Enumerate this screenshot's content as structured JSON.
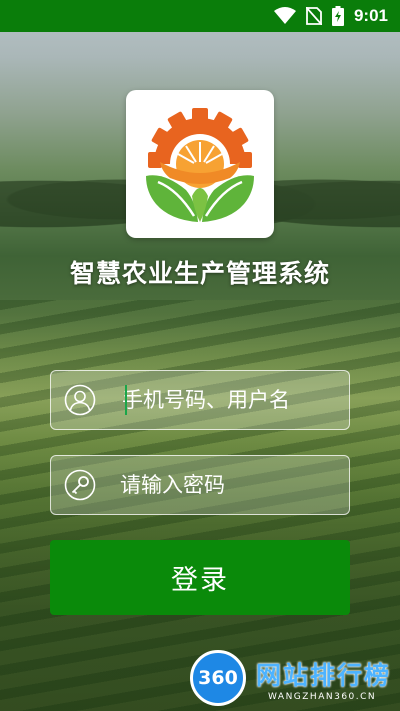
{
  "status_bar": {
    "time": "9:01",
    "icons": [
      "wifi-icon",
      "no-sim-icon",
      "battery-charging-icon"
    ]
  },
  "app": {
    "title": "智慧农业生产管理系统",
    "logo_icon": "agriculture-gear-leaf-logo"
  },
  "login_form": {
    "username_placeholder": "手机号码、用户名",
    "username_value": "",
    "username_icon": "user-icon",
    "password_placeholder": "请输入密码",
    "password_value": "",
    "password_icon": "key-icon",
    "login_label": "登录"
  },
  "watermark": {
    "badge": "360",
    "text": "网站排行榜",
    "sub": "WANGZHAN360.CN"
  },
  "colors": {
    "status_bar": "#0a7d0a",
    "login_button": "#0a8a0a",
    "logo_orange": "#e8641f",
    "logo_green": "#5fb43a"
  }
}
